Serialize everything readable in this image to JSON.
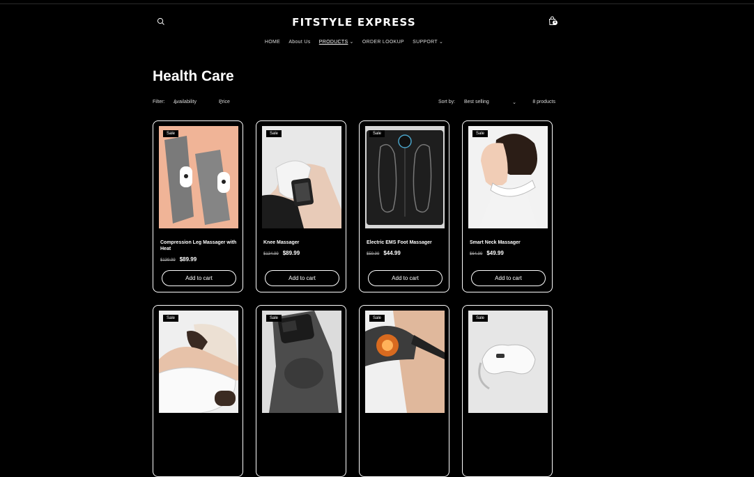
{
  "brand": "FITSTYLE EXPRESS",
  "cart_count": "1",
  "nav": [
    {
      "label": "HOME",
      "dropdown": false,
      "active": false
    },
    {
      "label": "About Us",
      "dropdown": false,
      "active": false
    },
    {
      "label": "PRODUCTS",
      "dropdown": true,
      "active": true
    },
    {
      "label": "ORDER LOOKUP",
      "dropdown": false,
      "active": false
    },
    {
      "label": "SUPPORT",
      "dropdown": true,
      "active": false
    }
  ],
  "page_title": "Health Care",
  "filters": {
    "label": "Filter:",
    "availability": "Availability",
    "price": "Price",
    "sort_label": "Sort by:",
    "sort_value": "Best selling",
    "count": "8 products"
  },
  "products": [
    {
      "badge": "Sale",
      "title": "Compression Leg Massager with Heat",
      "old_price": "$139.99",
      "price": "$89.99",
      "button": "Add to cart",
      "image": "leg-massager"
    },
    {
      "badge": "Sale",
      "title": "Knee Massager",
      "old_price": "$134.99",
      "price": "$89.99",
      "button": "Add to cart",
      "image": "knee-massager"
    },
    {
      "badge": "Sale",
      "title": "Electric EMS Foot Massager",
      "old_price": "$59.99",
      "price": "$44.99",
      "button": "Add to cart",
      "image": "foot-massager"
    },
    {
      "badge": "Sale",
      "title": "Smart Neck Massager",
      "old_price": "$64.99",
      "price": "$49.99",
      "button": "Add to cart",
      "image": "neck-massager"
    },
    {
      "badge": "Sale",
      "image": "hand-massager"
    },
    {
      "badge": "Sale",
      "image": "knee-wrap-massager"
    },
    {
      "badge": "Sale",
      "image": "shoulder-massager"
    },
    {
      "badge": "Sale",
      "image": "eye-massager"
    }
  ],
  "colors": {
    "background": "#000000",
    "text": "#ffffff",
    "border": "#ffffff"
  }
}
